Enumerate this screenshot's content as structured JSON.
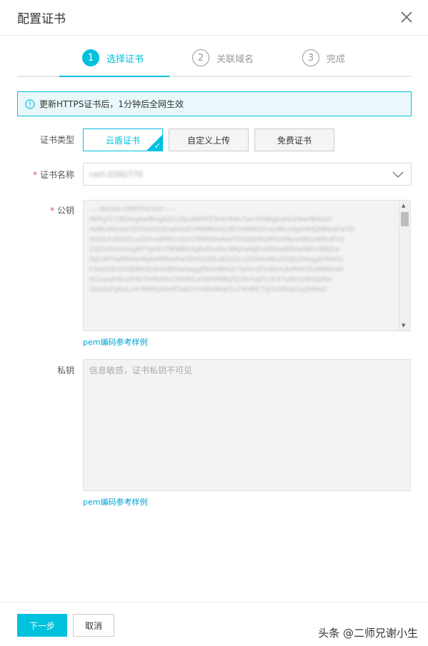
{
  "dialog": {
    "title": "配置证书"
  },
  "steps": [
    {
      "num": "1",
      "label": "选择证书",
      "active": true
    },
    {
      "num": "2",
      "label": "关联域名",
      "active": false
    },
    {
      "num": "3",
      "label": "完成",
      "active": false
    }
  ],
  "notice": {
    "text": "更新HTTPS证书后，1分钟后全网生效"
  },
  "form": {
    "cert_type_label": "证书类型",
    "cert_type_options": [
      "云盾证书",
      "自定义上传",
      "免费证书"
    ],
    "cert_name_label": "证书名称",
    "cert_name_value": "cert-2292770",
    "public_key_label": "公钥",
    "public_key_lines": [
      "-----BEGIN CERTIFICATE-----",
      "MIIFgTCCBGmgAwIBAgIQDs3bLdNRIFZ5kXnR4s7wxTANBgkqhkiG9w0BAQsF",
      "ADBuMQswCQYDVQQGEwJVUzEVMBMGA1UEChMMRGlnaUNlcnQgSW5jMRkwFwYD",
      "VQQLExB3d3cuZGlnaWNlcnQuY29tMS0wKwYDVQQDEyRFbmNyeXB0aW9uIEV2",
      "ZXJ5d2hlcmUgRFYgVExTIENBIC0gRzEwHhcNMjAwNjExMDAwMDAwWhcNMjEw",
      "NjExMTIwMDAwWjAbMRkwFwYDVQQDExB3d3cuZXhhbXBsZS5jb20wggEiMA0G",
      "CSqGSIb3DQEBAQUAA4IBDwAwggEKAoIBAQC7pXm2Ck9QvL8zR0hY5aWbN3eF",
      "tG1uJq4sKx2PdV7mRzHnC0iA6bLwYoE9fS8gTjU3vXqZ1c5rK7yWnO4hDpMe",
      "QbA2sFg6uLxVcN9tRj0kIoP3aEzYmS8dWqH1vT4nBfC7gUx5lKrJe2yZhMa0"
    ],
    "public_key_link": "pem编码参考样例",
    "private_key_label": "私钥",
    "private_key_placeholder": "信息敏感，证书私钥不可见",
    "private_key_link": "pem编码参考样例"
  },
  "footer": {
    "next_label": "下一步",
    "cancel_label": "取消"
  },
  "watermark": "头条 @二师兄谢小生",
  "colors": {
    "accent": "#00c1de",
    "required": "#e84e4e",
    "link": "#00a2d4"
  },
  "icons": {
    "close": "close-icon",
    "info": "info-icon",
    "check": "check-icon",
    "chevron": "chevron-down-icon"
  }
}
